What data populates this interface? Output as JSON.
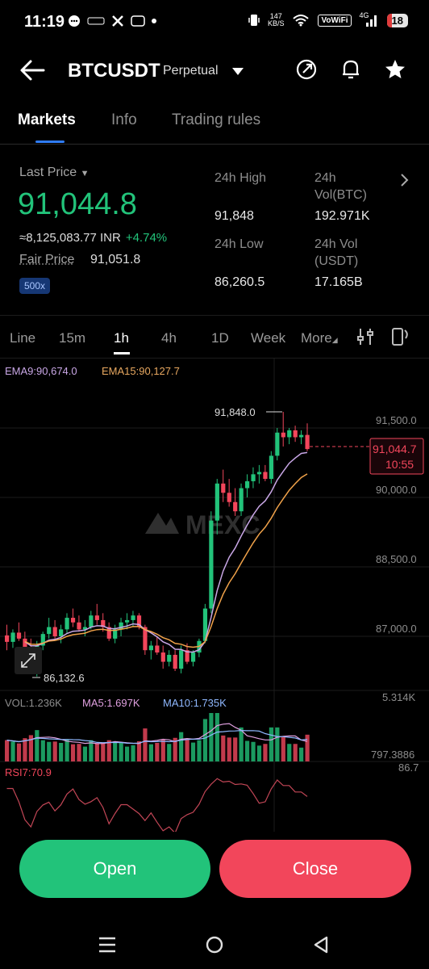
{
  "status_bar": {
    "time": "11:19",
    "net_speed_value": "147",
    "net_speed_unit": "KB/S",
    "vowifi": "VoWiFi",
    "signal_label": "4G",
    "battery": "18"
  },
  "header": {
    "symbol": "BTCUSDT",
    "contract_type": "Perpetual"
  },
  "tabs": [
    {
      "label": "Markets"
    },
    {
      "label": "Info"
    },
    {
      "label": "Trading rules"
    }
  ],
  "summary": {
    "last_price_label": "Last Price",
    "last_price": "91,044.8",
    "inr_value": "≈8,125,083.77 INR",
    "change": "+4.74%",
    "fair_price_label": "Fair Price",
    "fair_price": "91,051.8",
    "leverage": "500x",
    "high_label": "24h High",
    "high": "91,848",
    "vol_btc_label_1": "24h",
    "vol_btc_label_2": "Vol(BTC)",
    "vol_btc": "192.971K",
    "low_label": "24h Low",
    "low": "86,260.5",
    "vol_usdt_label_1": "24h Vol",
    "vol_usdt_label_2": "(USDT)",
    "vol_usdt": "17.165B"
  },
  "intervals": [
    {
      "label": "Line"
    },
    {
      "label": "15m"
    },
    {
      "label": "1h"
    },
    {
      "label": "4h"
    },
    {
      "label": "1D"
    },
    {
      "label": "Week"
    },
    {
      "label": "More"
    }
  ],
  "indicators": {
    "ema9": "EMA9:90,674.0",
    "ema15": "EMA15:90,127.7",
    "vol": "VOL:1.236K",
    "ma5": "MA5:1.697K",
    "ma10": "MA10:1.735K",
    "rsi": "RSI7:70.9"
  },
  "chart_labels": {
    "high_marker": "91,848.0",
    "low_marker": "86,132.6",
    "current_price": "91,044.7",
    "countdown": "10:55",
    "y_ticks": [
      "91,500.0",
      "90,000.0",
      "88,500.0",
      "87,000.0"
    ],
    "vol_max": "5.314K",
    "vol_min": "797.3886",
    "rsi_max": "86.7",
    "watermark": "MEXC"
  },
  "chart_data": {
    "type": "candlestick",
    "price_ticks": [
      91500,
      90000,
      88500,
      87000
    ],
    "last_price": 91044.7,
    "candles": [
      [
        87020,
        87250,
        86700,
        86880
      ],
      [
        86880,
        87150,
        86750,
        87080
      ],
      [
        87080,
        87300,
        86900,
        86950
      ],
      [
        86950,
        87100,
        86600,
        86700
      ],
      [
        86700,
        86950,
        86300,
        86450
      ],
      [
        86450,
        86900,
        86132.6,
        86800
      ],
      [
        86800,
        87100,
        86700,
        87050
      ],
      [
        87050,
        87400,
        86950,
        87200
      ],
      [
        87200,
        87350,
        86950,
        87000
      ],
      [
        87000,
        87250,
        86850,
        87150
      ],
      [
        87150,
        87500,
        87050,
        87400
      ],
      [
        87400,
        87600,
        87200,
        87300
      ],
      [
        87300,
        87450,
        87100,
        87150
      ],
      [
        87150,
        87350,
        87000,
        87200
      ],
      [
        87200,
        87550,
        87150,
        87450
      ],
      [
        87450,
        87700,
        87250,
        87350
      ],
      [
        87350,
        87500,
        87100,
        87200
      ],
      [
        87200,
        87300,
        86900,
        86950
      ],
      [
        86950,
        87250,
        86850,
        87150
      ],
      [
        87150,
        87400,
        87000,
        87300
      ],
      [
        87300,
        87500,
        87150,
        87350
      ],
      [
        87350,
        87550,
        87200,
        87450
      ],
      [
        87450,
        87500,
        87150,
        87200
      ],
      [
        87200,
        87250,
        86600,
        86700
      ],
      [
        86700,
        86900,
        86500,
        86800
      ],
      [
        86800,
        87000,
        86600,
        86650
      ],
      [
        86650,
        86800,
        86300,
        86450
      ],
      [
        86450,
        86700,
        86350,
        86600
      ],
      [
        86600,
        86700,
        86250,
        86300
      ],
      [
        86300,
        86800,
        86200,
        86700
      ],
      [
        86700,
        86850,
        86400,
        86450
      ],
      [
        86450,
        86700,
        86350,
        86650
      ],
      [
        86650,
        86950,
        86550,
        86900
      ],
      [
        86900,
        87700,
        86850,
        87600
      ],
      [
        87600,
        89700,
        87500,
        89500
      ],
      [
        89500,
        90400,
        89200,
        90300
      ],
      [
        90300,
        90600,
        89900,
        90100
      ],
      [
        90100,
        90400,
        89800,
        89900
      ],
      [
        89900,
        90200,
        89600,
        89700
      ],
      [
        89700,
        90300,
        89600,
        90200
      ],
      [
        90200,
        90500,
        90000,
        90350
      ],
      [
        90350,
        90650,
        90200,
        90500
      ],
      [
        90500,
        90700,
        90300,
        90550
      ],
      [
        90550,
        90700,
        90350,
        90400
      ],
      [
        90400,
        91000,
        90300,
        90900
      ],
      [
        90900,
        91500,
        90800,
        91400
      ],
      [
        91400,
        91848,
        91100,
        91300
      ],
      [
        91300,
        91500,
        91150,
        91450
      ],
      [
        91450,
        91550,
        91200,
        91300
      ],
      [
        91300,
        91450,
        91150,
        91350
      ],
      [
        91350,
        91600,
        91000,
        91044.7
      ]
    ],
    "volume_ticks": {
      "max": 5314,
      "min": 797.3886
    },
    "rsi_max": 86.7
  }
}
